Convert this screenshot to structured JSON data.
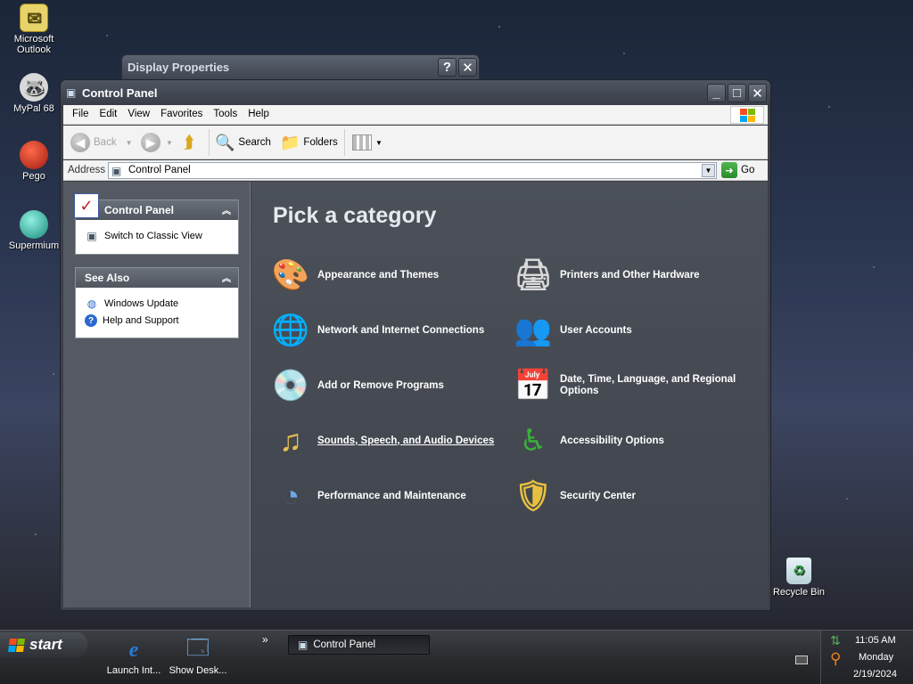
{
  "desktop": {
    "icons": [
      {
        "label": "Microsoft Outlook"
      },
      {
        "label": "MyPal 68"
      },
      {
        "label": "Pego"
      },
      {
        "label": "Supermium"
      }
    ],
    "recycle_bin": "Recycle Bin"
  },
  "back_window": {
    "title": "Display Properties",
    "help": "?",
    "close": "✕"
  },
  "window": {
    "title": "Control Panel",
    "controls": {
      "minimize": "_",
      "maximize": "□",
      "close": "✕"
    },
    "menu": [
      "File",
      "Edit",
      "View",
      "Favorites",
      "Tools",
      "Help"
    ],
    "toolbar": {
      "back": "Back",
      "search": "Search",
      "folders": "Folders"
    },
    "address": {
      "label": "Address",
      "value": "Control Panel",
      "go": "Go"
    },
    "left_pane": {
      "control_panel": {
        "title": "Control Panel",
        "links": [
          "Switch to Classic View"
        ]
      },
      "see_also": {
        "title": "See Also",
        "links": [
          "Windows Update",
          "Help and Support"
        ]
      }
    },
    "main": {
      "heading": "Pick a category",
      "categories": [
        {
          "label": "Appearance and Themes",
          "icon": "appearance-themes-icon"
        },
        {
          "label": "Printers and Other Hardware",
          "icon": "printer-icon"
        },
        {
          "label": "Network and Internet Connections",
          "icon": "network-globe-icon"
        },
        {
          "label": "User Accounts",
          "icon": "users-icon"
        },
        {
          "label": "Add or Remove Programs",
          "icon": "programs-cd-icon"
        },
        {
          "label": "Date, Time, Language, and Regional Options",
          "icon": "calendar-globe-icon"
        },
        {
          "label": "Sounds, Speech, and Audio Devices",
          "icon": "music-speaker-icon"
        },
        {
          "label": "Accessibility Options",
          "icon": "accessibility-icon"
        },
        {
          "label": "Performance and Maintenance",
          "icon": "performance-pie-icon"
        },
        {
          "label": "Security Center",
          "icon": "security-shield-icon"
        }
      ]
    }
  },
  "taskbar": {
    "start": "start",
    "quick_launch": [
      "Launch Int...",
      "Show Desk..."
    ],
    "more": "»",
    "tasks": [
      "Control Panel"
    ],
    "clock": {
      "time": "11:05 AM",
      "day": "Monday",
      "date": "2/19/2024"
    }
  }
}
